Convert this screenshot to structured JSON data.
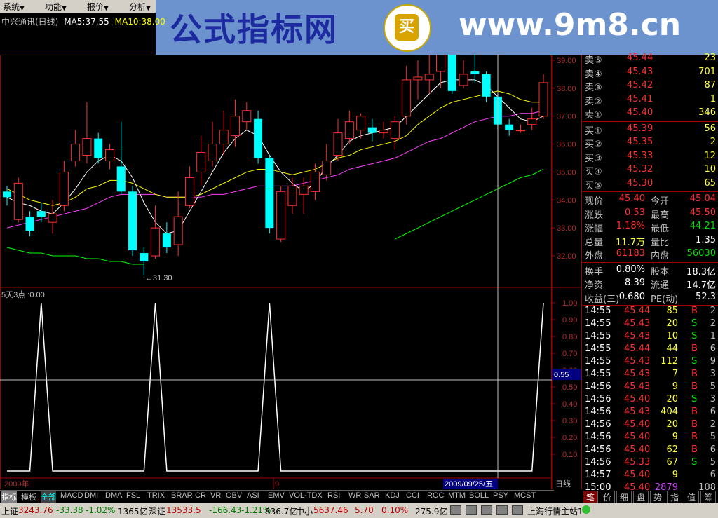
{
  "menubar": {
    "items": [
      "系统",
      "功能",
      "报价",
      "分析"
    ]
  },
  "brand": {
    "title": "公式指标网",
    "logo_char": "买",
    "url": "www.9m8.cn"
  },
  "chart": {
    "title": "中兴通讯(日线)",
    "ma5": "MA5:37.55",
    "ma10": "MA10:38.00",
    "low_marker": "←31.30",
    "y_ticks": [
      "39.00",
      "38.00",
      "37.00",
      "36.00",
      "35.00",
      "34.00",
      "33.00",
      "32.00"
    ],
    "indicator_label": "5天3点 :0.00",
    "ind_ticks": [
      "1.00",
      "0.90",
      "0.80",
      "0.70",
      "0.60",
      "0.50",
      "0.40",
      "0.30",
      "0.20",
      "0.10"
    ],
    "cursor_value": "0.55",
    "date_start": "2009年",
    "date_mid": "9",
    "date_cursor": "2009/09/25/五",
    "period": "日线"
  },
  "chart_data": {
    "type": "candlestick",
    "title": "中兴通讯(日线)",
    "ylim": [
      31.5,
      39.2
    ],
    "candles": [
      {
        "o": 34.3,
        "c": 34.1,
        "h": 34.5,
        "l": 33.8
      },
      {
        "o": 33.3,
        "c": 34.6,
        "h": 34.8,
        "l": 33.2
      },
      {
        "o": 33.4,
        "c": 32.9,
        "h": 33.6,
        "l": 32.7
      },
      {
        "o": 33.6,
        "c": 33.4,
        "h": 33.9,
        "l": 33.2
      },
      {
        "o": 33.2,
        "c": 33.5,
        "h": 34.0,
        "l": 32.8
      },
      {
        "o": 33.8,
        "c": 35.0,
        "h": 35.4,
        "l": 33.6
      },
      {
        "o": 35.4,
        "c": 36.0,
        "h": 36.5,
        "l": 35.2
      },
      {
        "o": 35.6,
        "c": 36.2,
        "h": 37.5,
        "l": 35.3
      },
      {
        "o": 36.2,
        "c": 35.5,
        "h": 36.4,
        "l": 35.3
      },
      {
        "o": 35.4,
        "c": 35.8,
        "h": 36.0,
        "l": 35.1
      },
      {
        "o": 35.2,
        "c": 34.3,
        "h": 36.8,
        "l": 34.2
      },
      {
        "o": 34.3,
        "c": 32.2,
        "h": 34.5,
        "l": 32.0
      },
      {
        "o": 32.1,
        "c": 31.8,
        "h": 32.3,
        "l": 31.3
      },
      {
        "o": 32.0,
        "c": 33.0,
        "h": 33.8,
        "l": 31.9
      },
      {
        "o": 32.8,
        "c": 32.3,
        "h": 33.2,
        "l": 32.1
      },
      {
        "o": 32.4,
        "c": 33.4,
        "h": 34.3,
        "l": 32.0
      },
      {
        "o": 33.8,
        "c": 34.8,
        "h": 35.2,
        "l": 33.7
      },
      {
        "o": 35.0,
        "c": 35.7,
        "h": 36.3,
        "l": 34.5
      },
      {
        "o": 35.4,
        "c": 36.0,
        "h": 36.8,
        "l": 35.2
      },
      {
        "o": 36.0,
        "c": 36.5,
        "h": 37.2,
        "l": 35.6
      },
      {
        "o": 36.3,
        "c": 37.0,
        "h": 37.6,
        "l": 35.9
      },
      {
        "o": 36.8,
        "c": 37.2,
        "h": 37.5,
        "l": 36.5
      },
      {
        "o": 36.9,
        "c": 35.5,
        "h": 37.2,
        "l": 35.3
      },
      {
        "o": 35.5,
        "c": 33.0,
        "h": 35.6,
        "l": 32.8
      },
      {
        "o": 32.6,
        "c": 34.3,
        "h": 34.5,
        "l": 32.5
      },
      {
        "o": 33.8,
        "c": 34.5,
        "h": 34.8,
        "l": 33.5
      },
      {
        "o": 34.2,
        "c": 34.5,
        "h": 34.8,
        "l": 33.5
      },
      {
        "o": 34.3,
        "c": 35.0,
        "h": 35.3,
        "l": 34.0
      },
      {
        "o": 34.9,
        "c": 35.4,
        "h": 36.0,
        "l": 34.7
      },
      {
        "o": 35.6,
        "c": 36.4,
        "h": 36.9,
        "l": 35.4
      },
      {
        "o": 36.2,
        "c": 36.8,
        "h": 37.2,
        "l": 36.0
      },
      {
        "o": 36.5,
        "c": 37.0,
        "h": 37.1,
        "l": 36.2
      },
      {
        "o": 36.6,
        "c": 36.4,
        "h": 36.9,
        "l": 36.1
      },
      {
        "o": 36.4,
        "c": 36.5,
        "h": 36.8,
        "l": 36.2
      },
      {
        "o": 36.2,
        "c": 36.8,
        "h": 37.0,
        "l": 35.8
      },
      {
        "o": 37.0,
        "c": 38.3,
        "h": 38.8,
        "l": 36.7
      },
      {
        "o": 38.3,
        "c": 38.4,
        "h": 39.0,
        "l": 37.6
      },
      {
        "o": 38.3,
        "c": 38.5,
        "h": 39.5,
        "l": 37.8
      },
      {
        "o": 38.6,
        "c": 39.2,
        "h": 39.3,
        "l": 38.0
      },
      {
        "o": 39.2,
        "c": 37.9,
        "h": 39.3,
        "l": 37.8
      },
      {
        "o": 38.1,
        "c": 38.5,
        "h": 39.0,
        "l": 38.0
      },
      {
        "o": 38.6,
        "c": 38.5,
        "h": 39.2,
        "l": 38.2
      },
      {
        "o": 38.5,
        "c": 37.7,
        "h": 38.6,
        "l": 37.5
      },
      {
        "o": 37.7,
        "c": 36.7,
        "h": 37.8,
        "l": 36.5
      },
      {
        "o": 36.7,
        "c": 36.5,
        "h": 36.9,
        "l": 36.3
      },
      {
        "o": 36.5,
        "c": 36.5,
        "h": 36.7,
        "l": 36.4
      },
      {
        "o": 36.7,
        "c": 36.9,
        "h": 37.3,
        "l": 36.5
      },
      {
        "o": 37.0,
        "c": 38.2,
        "h": 38.5,
        "l": 36.9
      }
    ],
    "ma5": [
      34.1,
      33.9,
      33.8,
      33.6,
      33.5,
      33.9,
      34.4,
      35.0,
      35.4,
      35.6,
      35.4,
      34.8,
      33.9,
      33.2,
      32.8,
      32.9,
      33.6,
      34.3,
      35.0,
      35.7,
      36.2,
      36.5,
      36.3,
      35.6,
      35.0,
      34.6,
      34.3,
      34.6,
      35.2,
      35.6,
      36.1,
      36.3,
      36.4,
      36.5,
      36.6,
      37.0,
      37.4,
      37.8,
      38.2,
      38.3,
      38.3,
      38.3,
      38.1,
      37.7,
      37.3,
      36.9,
      36.8,
      37.0
    ],
    "ma10": [
      34.4,
      34.2,
      34.0,
      33.9,
      33.8,
      33.9,
      34.1,
      34.4,
      34.5,
      34.7,
      34.7,
      34.6,
      34.4,
      34.2,
      34.1,
      34.1,
      34.1,
      34.2,
      34.4,
      34.6,
      34.8,
      35.0,
      35.1,
      35.1,
      35.0,
      34.9,
      35.0,
      35.1,
      35.3,
      35.5,
      35.6,
      35.8,
      35.9,
      36.0,
      36.1,
      36.3,
      36.7,
      37.0,
      37.3,
      37.5,
      37.6,
      37.7,
      37.8,
      37.9,
      37.8,
      37.6,
      37.5,
      37.5
    ],
    "ma20": [
      33.0,
      33.1,
      33.2,
      33.3,
      33.4,
      33.5,
      33.6,
      33.7,
      33.9,
      34.1,
      34.2,
      34.2,
      34.2,
      34.2,
      34.1,
      34.1,
      34.1,
      34.1,
      34.2,
      34.2,
      34.3,
      34.4,
      34.5,
      34.5,
      34.5,
      34.5,
      34.6,
      34.7,
      34.8,
      34.9,
      35.1,
      35.2,
      35.3,
      35.4,
      35.5,
      35.7,
      35.9,
      36.1,
      36.2,
      36.4,
      36.6,
      36.8,
      36.9,
      37.0,
      37.0,
      37.1,
      37.1,
      37.2
    ],
    "ma60_partial": [
      32.3,
      32.2,
      32.1,
      32.1,
      32.0,
      32.0,
      32.0,
      31.9,
      31.9,
      31.8,
      31.8,
      31.7,
      31.7
    ],
    "ma60_tail": [
      32.6,
      32.8,
      33.0,
      33.2,
      33.4,
      33.6,
      33.8,
      34.0,
      34.2,
      34.4,
      34.6,
      34.8,
      34.9,
      35.1
    ],
    "indicator": [
      0,
      0,
      0,
      1,
      0,
      0,
      0,
      0,
      0,
      0,
      0,
      0,
      0,
      1,
      0,
      0,
      0,
      0,
      0,
      0,
      0,
      0,
      0,
      1,
      0,
      0,
      0,
      0,
      0,
      0,
      0,
      0,
      0,
      0,
      0,
      0,
      0,
      0,
      0,
      0,
      0,
      0,
      0,
      0,
      0,
      0,
      0,
      1
    ]
  },
  "quote": {
    "asks": [
      {
        "label": "卖⑤",
        "price": "45.44",
        "vol": "23"
      },
      {
        "label": "卖④",
        "price": "45.43",
        "vol": "701"
      },
      {
        "label": "卖③",
        "price": "45.42",
        "vol": "87"
      },
      {
        "label": "卖②",
        "price": "45.41",
        "vol": "1"
      },
      {
        "label": "卖①",
        "price": "45.40",
        "vol": "346"
      }
    ],
    "bids": [
      {
        "label": "买①",
        "price": "45.39",
        "vol": "56"
      },
      {
        "label": "买②",
        "price": "45.35",
        "vol": "2"
      },
      {
        "label": "买③",
        "price": "45.33",
        "vol": "12"
      },
      {
        "label": "买④",
        "price": "45.32",
        "vol": "10"
      },
      {
        "label": "买⑤",
        "price": "45.30",
        "vol": "65"
      }
    ],
    "stats": [
      {
        "l1": "现价",
        "v1": "45.40",
        "l2": "今开",
        "v2": "45.04"
      },
      {
        "l1": "涨跌",
        "v1": "0.53",
        "l2": "最高",
        "v2": "45.50"
      },
      {
        "l1": "涨幅",
        "v1": "1.18%",
        "l2": "最低",
        "v2": "44.21"
      },
      {
        "l1": "总量",
        "v1": "11.7万",
        "l2": "量比",
        "v2": "1.35"
      },
      {
        "l1": "外盘",
        "v1": "61183",
        "l2": "内盘",
        "v2": "56030"
      }
    ],
    "fund": [
      {
        "l1": "换手",
        "v1": "0.80%",
        "l2": "股本",
        "v2": "18.3亿"
      },
      {
        "l1": "净资",
        "v1": "8.39",
        "l2": "流通",
        "v2": "14.7亿"
      },
      {
        "l1": "收益(三)",
        "v1": "0.680",
        "l2": "PE(动)",
        "v2": "52.3"
      }
    ],
    "ticks": [
      {
        "t": "14:55",
        "p": "45.44",
        "v": "85",
        "s": "B",
        "n": "2"
      },
      {
        "t": "14:55",
        "p": "45.43",
        "v": "20",
        "s": "S",
        "n": "2"
      },
      {
        "t": "14:55",
        "p": "45.43",
        "v": "10",
        "s": "S",
        "n": "1"
      },
      {
        "t": "14:55",
        "p": "45.44",
        "v": "44",
        "s": "B",
        "n": "6"
      },
      {
        "t": "14:55",
        "p": "45.43",
        "v": "112",
        "s": "S",
        "n": "9"
      },
      {
        "t": "14:55",
        "p": "45.43",
        "v": "7",
        "s": "B",
        "n": "3"
      },
      {
        "t": "14:56",
        "p": "45.43",
        "v": "9",
        "s": "B",
        "n": "5"
      },
      {
        "t": "14:56",
        "p": "45.40",
        "v": "20",
        "s": "S",
        "n": "3"
      },
      {
        "t": "14:56",
        "p": "45.43",
        "v": "404",
        "s": "B",
        "n": "6"
      },
      {
        "t": "14:56",
        "p": "45.40",
        "v": "20",
        "s": "B",
        "n": "2"
      },
      {
        "t": "14:56",
        "p": "45.40",
        "v": "9",
        "s": "B",
        "n": "5"
      },
      {
        "t": "14:56",
        "p": "45.40",
        "v": "62",
        "s": "B",
        "n": "6"
      },
      {
        "t": "14:56",
        "p": "45.33",
        "v": "67",
        "s": "S",
        "n": "5"
      },
      {
        "t": "14:57",
        "p": "45.40",
        "v": "9",
        "s": "",
        "n": "6"
      },
      {
        "t": "15:00",
        "p": "45.40",
        "v": "2879",
        "s": "",
        "n": "108"
      }
    ]
  },
  "tabs": [
    "指标",
    "模板",
    "全部",
    "MACD",
    "DMI",
    "DMA",
    "FSL",
    "TRIX",
    "BRAR",
    "CR",
    "VR",
    "OBV",
    "ASI",
    "EMV",
    "VOL-TDX",
    "RSI",
    "WR",
    "SAR",
    "KDJ",
    "CCI",
    "ROC",
    "MTM",
    "BOLL",
    "PSY",
    "MCST"
  ],
  "rtabs": [
    "笔",
    "价",
    "细",
    "盘",
    "势",
    "指",
    "值",
    "筹"
  ],
  "status": {
    "sh_label": "上证",
    "sh_val": "3243.76",
    "sh_chg": "-33.38",
    "sh_pct": "-1.02%",
    "sh_amt": "1365亿",
    "sz_label": "深证",
    "sz_val": "13533.5",
    "sz_chg": "-166.43",
    "sz_pct": "-1.21%",
    "sz_amt": "836.7亿",
    "zx_label": "中小",
    "zx_val": "5637.46",
    "zx_chg": "5.70",
    "zx_pct": "0.10%",
    "zx_amt": "275.9亿",
    "server": "上海行情主站1"
  },
  "colors": {
    "up": "#ff3030",
    "down": "#00ffff",
    "ma5": "#ffffff",
    "ma10": "#ffff00",
    "ma20": "#ff40ff",
    "ma60": "#00ff00"
  }
}
